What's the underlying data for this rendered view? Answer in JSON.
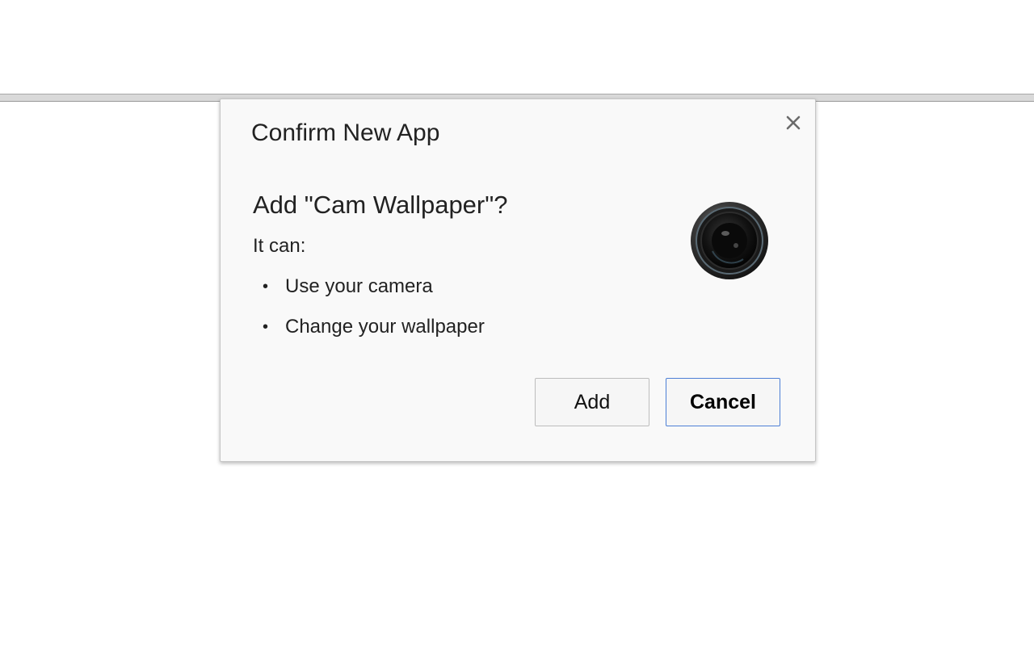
{
  "dialog": {
    "title": "Confirm New App",
    "heading": "Add \"Cam Wallpaper\"?",
    "subheading": "It can:",
    "permissions": [
      {
        "bullet": "•",
        "text": "Use your camera"
      },
      {
        "bullet": "•",
        "text": "Change your wallpaper"
      }
    ],
    "app_icon": "camera-lens-icon",
    "close_icon": "close-icon",
    "add_label": "Add",
    "cancel_label": "Cancel"
  },
  "colors": {
    "dialog_background": "#f9f9f9",
    "text": "#222222",
    "focus_border": "#4d7fd6",
    "top_bar": "#d9d9d9"
  }
}
